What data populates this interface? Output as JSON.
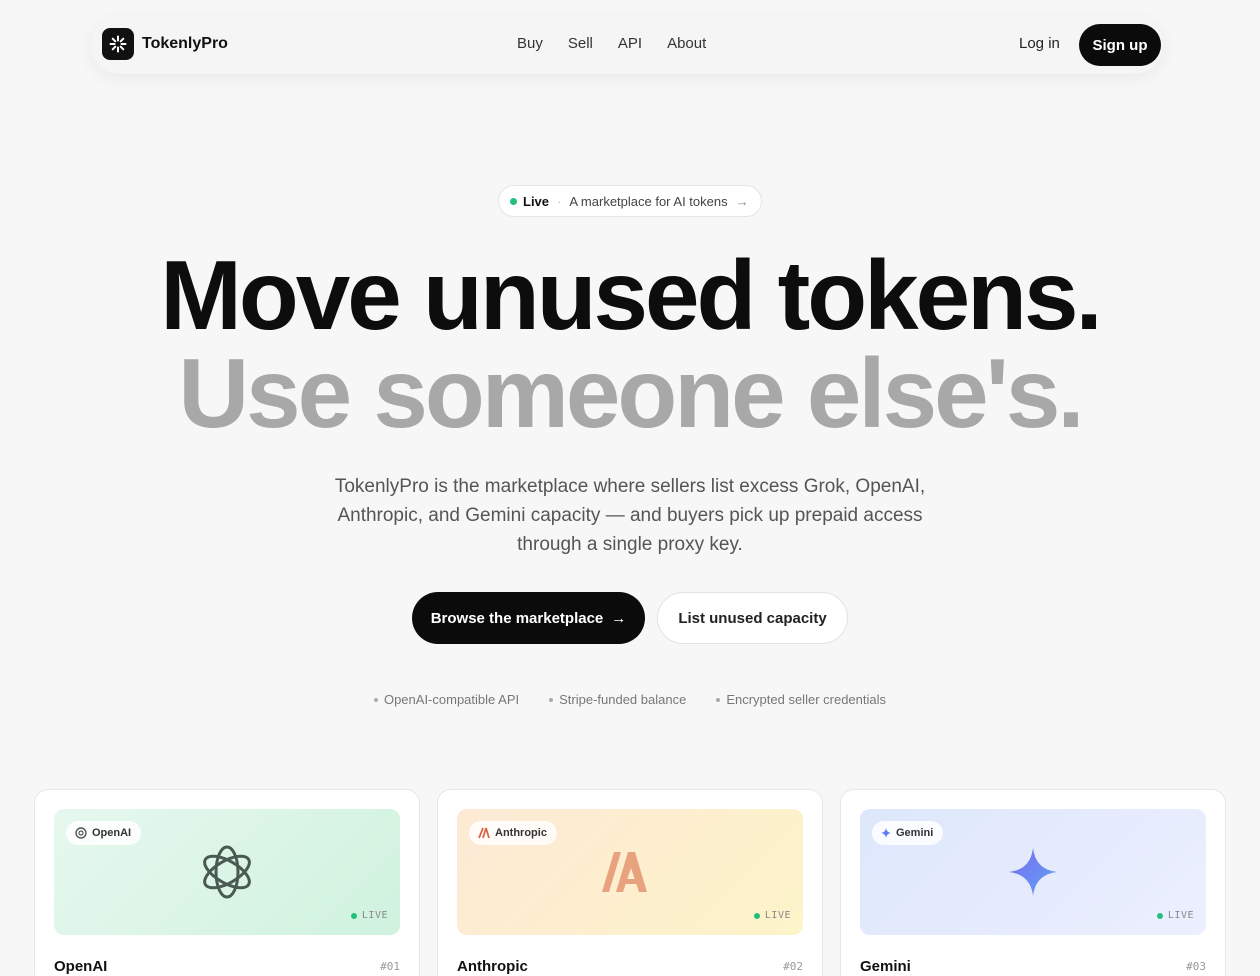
{
  "nav": {
    "brand": "TokenlyPro",
    "links": [
      "Buy",
      "Sell",
      "API",
      "About"
    ],
    "login": "Log in",
    "signup": "Sign up"
  },
  "pill": {
    "status": "Live",
    "separator": "·",
    "text": "A marketplace for AI tokens",
    "arrow": "→"
  },
  "hero": {
    "line1": "Move unused tokens.",
    "line2": "Use someone else's.",
    "subtitle": "TokenlyPro is the marketplace where sellers list excess Grok, OpenAI, Anthropic, and Gemini capacity — and buyers pick up prepaid access through a single proxy key."
  },
  "cta": {
    "primary": "Browse the marketplace",
    "primary_arrow": "→",
    "secondary": "List unused capacity"
  },
  "features": [
    "OpenAI-compatible API",
    "Stripe-funded balance",
    "Encrypted seller credentials"
  ],
  "cards": [
    {
      "chip": "OpenAI",
      "title": "OpenAI",
      "num": "#01",
      "status": "LIVE",
      "icon": "openai-icon",
      "gradient": [
        "#e6f7ee",
        "#d2f3e0"
      ]
    },
    {
      "chip": "Anthropic",
      "title": "Anthropic",
      "num": "#02",
      "status": "LIVE",
      "icon": "anthropic-icon",
      "gradient": [
        "#fdeed7",
        "#fdf3cc"
      ]
    },
    {
      "chip": "Gemini",
      "title": "Gemini",
      "num": "#03",
      "status": "LIVE",
      "icon": "gemini-icon",
      "gradient": [
        "#dfe8fb",
        "#eaeefc"
      ]
    }
  ],
  "colors": {
    "accent_dark": "#0b0b0b",
    "live_green": "#22c07a",
    "headline_muted": "#a8a8a8"
  }
}
